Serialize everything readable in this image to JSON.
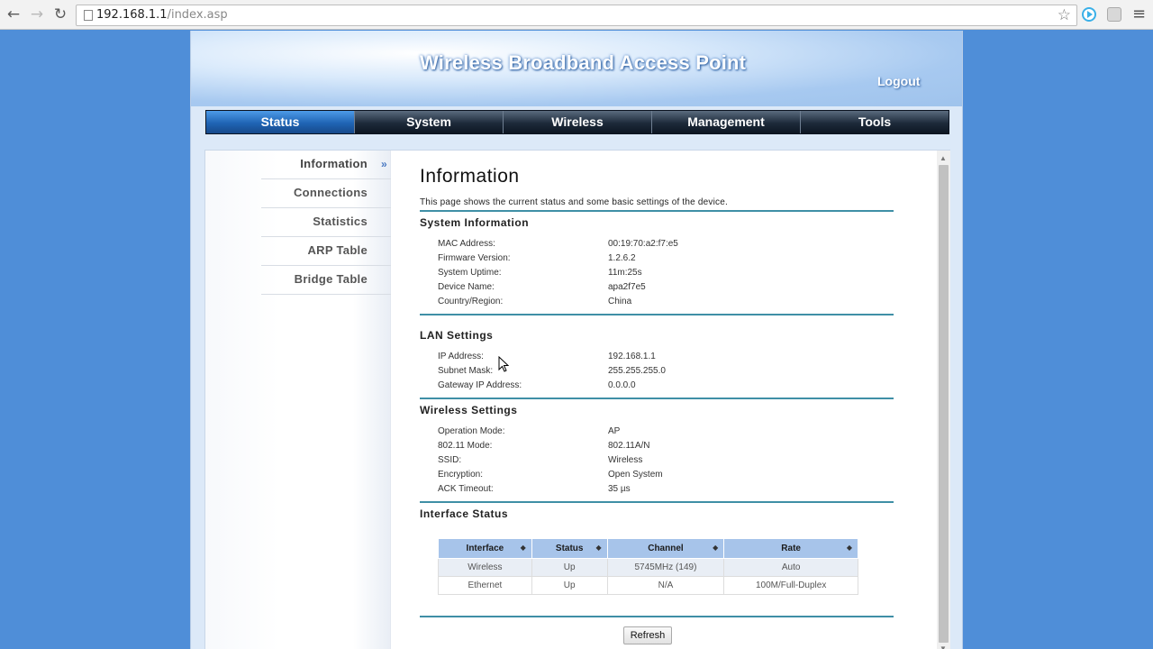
{
  "browser": {
    "url_host": "192.168.1.1",
    "url_path": "/index.asp",
    "back_icon": "back-arrow-icon",
    "forward_icon": "forward-arrow-icon",
    "reload_icon": "reload-icon"
  },
  "header": {
    "title": "Wireless Broadband Access Point",
    "logout": "Logout"
  },
  "menu": {
    "items": [
      {
        "label": "Status"
      },
      {
        "label": "System"
      },
      {
        "label": "Wireless"
      },
      {
        "label": "Management"
      },
      {
        "label": "Tools"
      }
    ],
    "active": "Status"
  },
  "sidebar": {
    "items": [
      {
        "label": "Information"
      },
      {
        "label": "Connections"
      },
      {
        "label": "Statistics"
      },
      {
        "label": "ARP Table"
      },
      {
        "label": "Bridge Table"
      }
    ],
    "active": "Information"
  },
  "main": {
    "title": "Information",
    "description": "This page shows the current status and some basic settings of the device.",
    "system_info": {
      "title": "System Information",
      "rows": [
        {
          "label": "MAC Address:",
          "value": "00:19:70:a2:f7:e5"
        },
        {
          "label": "Firmware Version:",
          "value": "1.2.6.2"
        },
        {
          "label": "System Uptime:",
          "value": "11m:25s"
        },
        {
          "label": "Device Name:",
          "value": "apa2f7e5"
        },
        {
          "label": "Country/Region:",
          "value": "China"
        }
      ]
    },
    "lan": {
      "title": "LAN Settings",
      "rows": [
        {
          "label": "IP Address:",
          "value": "192.168.1.1"
        },
        {
          "label": "Subnet Mask:",
          "value": "255.255.255.0"
        },
        {
          "label": "Gateway IP Address:",
          "value": "0.0.0.0"
        }
      ]
    },
    "wireless": {
      "title": "Wireless Settings",
      "rows": [
        {
          "label": "Operation Mode:",
          "value": "AP"
        },
        {
          "label": "802.11 Mode:",
          "value": "802.11A/N"
        },
        {
          "label": "SSID:",
          "value": "Wireless"
        },
        {
          "label": "Encryption:",
          "value": "Open System"
        },
        {
          "label": "ACK Timeout:",
          "value": "35 µs"
        }
      ]
    },
    "interface": {
      "title": "Interface Status",
      "columns": [
        "Interface",
        "Status",
        "Channel",
        "Rate"
      ],
      "rows": [
        [
          "Wireless",
          "Up",
          "5745MHz (149)",
          "Auto"
        ],
        [
          "Ethernet",
          "Up",
          "N/A",
          "100M/Full-Duplex"
        ]
      ]
    },
    "refresh": "Refresh"
  }
}
